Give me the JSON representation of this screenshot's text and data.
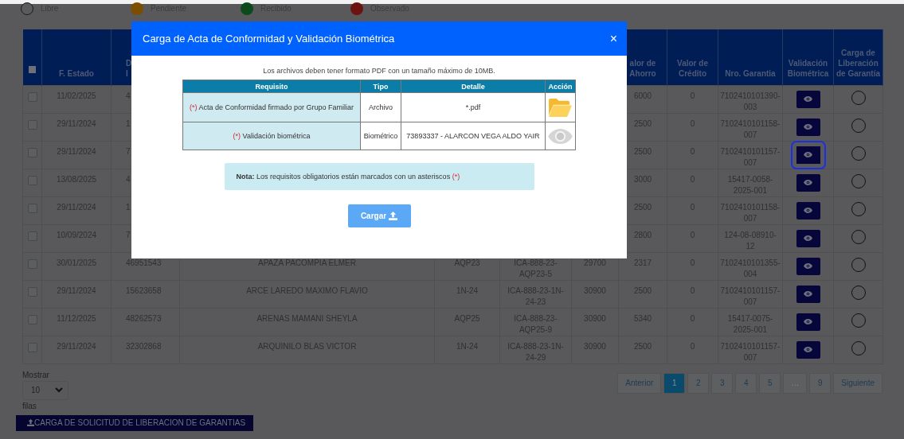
{
  "legend": [
    {
      "label": "Libre",
      "kind": "libre",
      "color": "#5a5b5d"
    },
    {
      "label": "Pendiente",
      "kind": "pendiente",
      "color": "#7a4d00"
    },
    {
      "label": "Recibido",
      "kind": "recibido",
      "color": "#0a4a1c"
    },
    {
      "label": "Observado",
      "kind": "observado",
      "color": "#6b1310"
    }
  ],
  "table": {
    "select_all": {
      "checked": false
    },
    "columns": [
      {
        "label": "F. Estado"
      },
      {
        "label": "D\nI"
      },
      {},
      {},
      {},
      {},
      {
        "label": "alor de\nAhorro"
      },
      {
        "label": "Valor de Crédito"
      },
      {
        "label": "Nro. Garantia"
      },
      {
        "label": "Validación Biométrica"
      },
      {
        "label": "Carga de Liberación de Garantía"
      }
    ],
    "rows": [
      {
        "checked": false,
        "focused": false,
        "selected": false,
        "cells": [
          "11/02/2025",
          "4",
          "",
          "",
          "",
          "",
          "6000",
          "0",
          "7102410101390-003"
        ]
      },
      {
        "checked": false,
        "focused": false,
        "selected": false,
        "cells": [
          "29/11/2024",
          "1",
          "",
          "",
          "",
          "",
          "2500",
          "0",
          "7102410101158-007"
        ]
      },
      {
        "checked": false,
        "focused": true,
        "selected": false,
        "cells": [
          "29/11/2024",
          "7",
          "",
          "",
          "",
          "",
          "2500",
          "0",
          "7102410101157-007"
        ]
      },
      {
        "checked": false,
        "focused": false,
        "selected": false,
        "cells": [
          "13/08/2025",
          "4",
          "",
          "",
          "",
          "",
          "3000",
          "0",
          "15417-0058-2025-001"
        ]
      },
      {
        "checked": false,
        "focused": false,
        "selected": false,
        "cells": [
          "29/11/2024",
          "1",
          "",
          "",
          "",
          "",
          "2500",
          "0",
          "7102410101158-007"
        ]
      },
      {
        "checked": false,
        "focused": false,
        "selected": false,
        "cells": [
          "10/09/2024",
          "7",
          "",
          "",
          "",
          "",
          "2800",
          "0",
          "124-08-08910-12"
        ]
      },
      {
        "checked": false,
        "focused": false,
        "selected": false,
        "cells": [
          "30/01/2025",
          "46951543",
          "APAZA PACOMPIA ELMER",
          "AQP23",
          "ICA-888-23-AQP23-5",
          "29700",
          "2317",
          "0",
          "7102410101355-004"
        ]
      },
      {
        "checked": false,
        "focused": false,
        "selected": false,
        "cells": [
          "29/11/2024",
          "15623658",
          "ARCE LAREDO MAXIMO FLAVIO",
          "1N-24",
          "ICA-888-23-1N-24-23",
          "30900",
          "2500",
          "0",
          "7102410101157-007"
        ]
      },
      {
        "checked": false,
        "focused": false,
        "selected": false,
        "cells": [
          "11/12/2025",
          "48262573",
          "ARENAS MAMANI SHEYLA",
          "AQP25",
          "ICA-888-23-AQP25-9",
          "30900",
          "5340",
          "0",
          "15417-0075-2025-001"
        ]
      },
      {
        "checked": false,
        "focused": false,
        "selected": false,
        "cells": [
          "29/11/2024",
          "32302868",
          "ARQUINILO BLAS VICTOR",
          "1N-24",
          "ICA-888-23-1N-24-29",
          "30900",
          "2500",
          "0",
          "7102410101157-007"
        ]
      }
    ]
  },
  "page_size": {
    "label": "Mostrar",
    "value": "10",
    "suffix": "filas"
  },
  "pagination": [
    {
      "label": "Anterior",
      "selected": false,
      "disabled": false
    },
    {
      "label": "1",
      "selected": true,
      "disabled": false
    },
    {
      "label": "2",
      "selected": false,
      "disabled": false
    },
    {
      "label": "3",
      "selected": false,
      "disabled": false
    },
    {
      "label": "4",
      "selected": false,
      "disabled": false
    },
    {
      "label": "5",
      "selected": false,
      "disabled": false
    },
    {
      "label": "…",
      "selected": false,
      "disabled": true
    },
    {
      "label": "9",
      "selected": false,
      "disabled": false
    },
    {
      "label": "Siguiente",
      "selected": false,
      "disabled": false
    }
  ],
  "bottom_button": "CARGA DE SOLICITUD DE LIBERACION DE GARANTIAS",
  "modal": {
    "title": "Carga de Acta de Conformidad y Validación Biométrica",
    "close": "×",
    "intro": "Los archivos deben tener formato PDF con un tamaño máximo de 10MB.",
    "columns": [
      "Requisito",
      "Tipo",
      "Detalle",
      "Acción"
    ],
    "rows": [
      {
        "kind": "file",
        "marker": "(*)",
        "requirement": "Acta de Conformidad firmado por Grupo Familiar",
        "type": "Archivo",
        "detail": "*.pdf"
      },
      {
        "kind": "biometric",
        "marker": "(*)",
        "requirement": "Validación biométrica",
        "type": "Biométrico",
        "detail": "73893337 - ALARCON VEGA ALDO YAIR"
      }
    ],
    "note": {
      "label": "Nota:",
      "text": "Los requisitos obligatorios están marcados con un asteriscos",
      "marker": "(*)"
    },
    "button": "Cargar"
  }
}
